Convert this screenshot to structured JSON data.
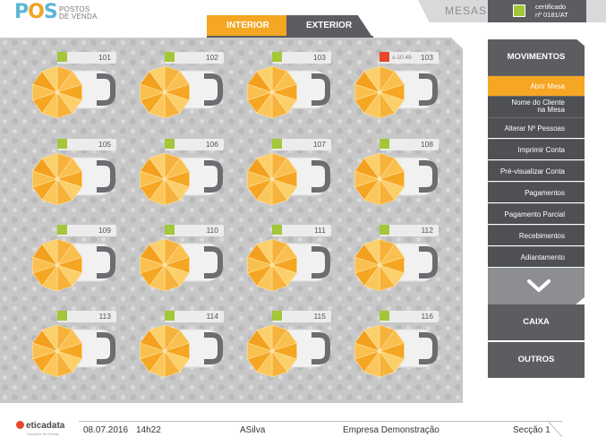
{
  "header": {
    "logo_mark": "POS",
    "logo_text_line1": "POSTOS",
    "logo_text_line2": "DE VENDA",
    "tabs": [
      {
        "label": "INTERIOR",
        "active": true
      },
      {
        "label": "EXTERIOR",
        "active": false
      }
    ],
    "section_title": "MESAS",
    "certificate": {
      "line1": "certificado",
      "line2": "nº 0181/AT"
    }
  },
  "tables": [
    {
      "number": "101",
      "status": "free",
      "time": ""
    },
    {
      "number": "102",
      "status": "free",
      "time": ""
    },
    {
      "number": "103",
      "status": "free",
      "time": ""
    },
    {
      "number": "103",
      "status": "occupied",
      "time": "s-10:49"
    },
    {
      "number": "105",
      "status": "free",
      "time": ""
    },
    {
      "number": "106",
      "status": "free",
      "time": ""
    },
    {
      "number": "107",
      "status": "free",
      "time": ""
    },
    {
      "number": "108",
      "status": "free",
      "time": ""
    },
    {
      "number": "109",
      "status": "free",
      "time": ""
    },
    {
      "number": "110",
      "status": "free",
      "time": ""
    },
    {
      "number": "111",
      "status": "free",
      "time": ""
    },
    {
      "number": "112",
      "status": "free",
      "time": ""
    },
    {
      "number": "113",
      "status": "free",
      "time": ""
    },
    {
      "number": "114",
      "status": "free",
      "time": ""
    },
    {
      "number": "115",
      "status": "free",
      "time": ""
    },
    {
      "number": "116",
      "status": "free",
      "time": ""
    }
  ],
  "menu": {
    "header": "MOVIMENTOS",
    "items": [
      {
        "label": "Abrir Mesa",
        "active": true
      },
      {
        "label": "Nome do Cliente na Mesa",
        "line1": "Nome do Cliente",
        "line2": "na Mesa",
        "active": false
      },
      {
        "label": "Alterar Nº Pessoas",
        "active": false
      },
      {
        "label": "Imprimir Conta",
        "active": false
      },
      {
        "label": "Pré-visualizar Conta",
        "active": false
      },
      {
        "label": "Pagamentos",
        "active": false
      },
      {
        "label": "Pagamento Parcial",
        "active": false
      },
      {
        "label": "Recebimentos",
        "active": false
      },
      {
        "label": "Adiantamento",
        "active": false
      }
    ],
    "scroll_icon": "chevron-down-icon",
    "caixa": "CAIXA",
    "outros": "OUTROS"
  },
  "statusbar": {
    "brand": "eticadata",
    "brand_sub": "Soluções de Gestão",
    "date": "08.07.2016",
    "time": "14h22",
    "user": "ASilva",
    "company": "Empresa Demonstração",
    "section": "Secção 1"
  },
  "colors": {
    "accent": "#f5a623",
    "dark": "#5b5d60",
    "free_status": "#a4c639",
    "occupied_status": "#e8472a"
  }
}
